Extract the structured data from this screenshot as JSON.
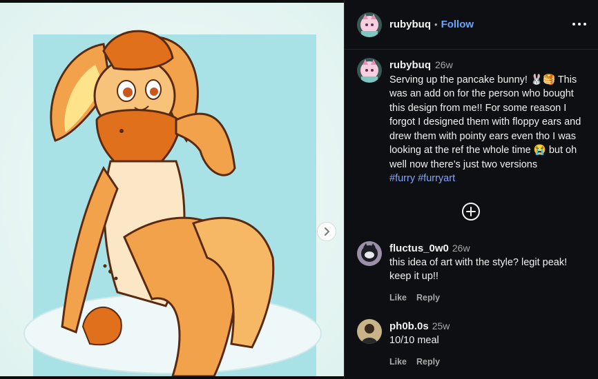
{
  "post": {
    "author": "rubybuq",
    "follow_label": "Follow",
    "separator": "•",
    "caption": {
      "author": "rubybuq",
      "time": "26w",
      "text": "Serving up the pancake bunny! 🐰🥞 This was an add on for the person who bought this design from me!! For some reason I forgot I designed them with floppy ears and drew them with pointy ears even tho I was looking at the ref the whole time 😭 but oh well now there’s just two versions",
      "hashtags": [
        "#furry",
        "#furryart"
      ]
    }
  },
  "comments": [
    {
      "author": "fluctus_0w0",
      "time": "26w",
      "text": "this idea of art with the style? legit peak! keep it up!!",
      "like_label": "Like",
      "reply_label": "Reply"
    },
    {
      "author": "ph0b.0s",
      "time": "25w",
      "text": "10/10 meal",
      "like_label": "Like",
      "reply_label": "Reply"
    }
  ],
  "icons": {
    "more": "more-options-icon",
    "next": "chevron-right-icon",
    "load_more": "plus-circle-icon"
  },
  "colors": {
    "background": "#0e0f12",
    "link": "#6aa6ff",
    "hashtag": "#7fa7ff",
    "muted": "#a8a8a8"
  }
}
